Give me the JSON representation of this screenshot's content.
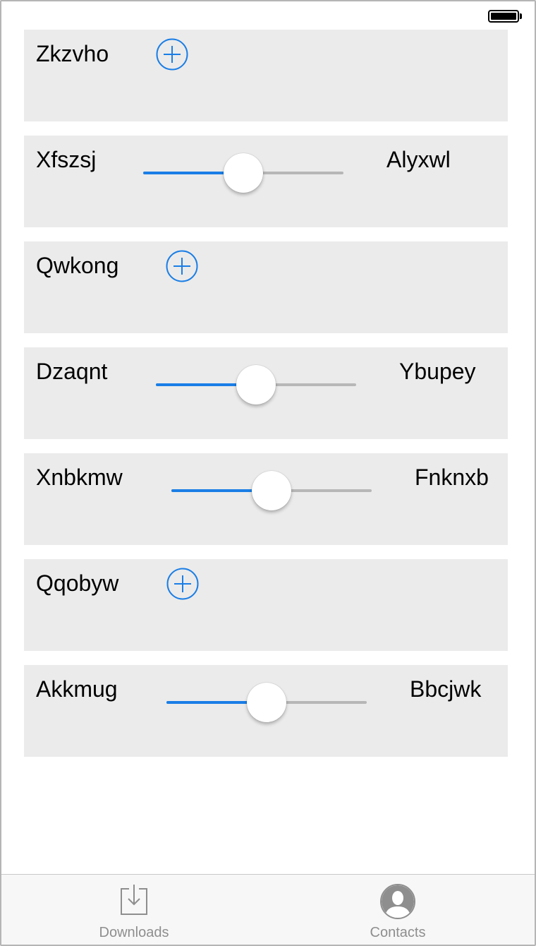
{
  "colors": {
    "accent": "#1a7ee6",
    "row_background": "#ebebeb",
    "track_inactive": "#b7b7b7",
    "tab_inactive": "#8e8e8e"
  },
  "rows": [
    {
      "label": "Zkzvho",
      "control": "add-button",
      "icon": "plus-circle-icon"
    },
    {
      "label": "Xfszsj",
      "control": "slider",
      "slider_value": 0.5,
      "value_text": "Alyxwl"
    },
    {
      "label": "Qwkong",
      "control": "add-button",
      "icon": "plus-circle-icon"
    },
    {
      "label": "Dzaqnt",
      "control": "slider",
      "slider_value": 0.5,
      "value_text": "Ybupey"
    },
    {
      "label": "Xnbkmw",
      "control": "slider",
      "slider_value": 0.5,
      "value_text": "Fnknxb"
    },
    {
      "label": "Qqobyw",
      "control": "add-button",
      "icon": "plus-circle-icon"
    },
    {
      "label": "Akkmug",
      "control": "slider",
      "slider_value": 0.5,
      "value_text": "Bbcjwk"
    }
  ],
  "tab_bar": {
    "tabs": [
      {
        "label": "Downloads",
        "icon": "downloads-icon"
      },
      {
        "label": "Contacts",
        "icon": "contacts-icon"
      }
    ]
  }
}
